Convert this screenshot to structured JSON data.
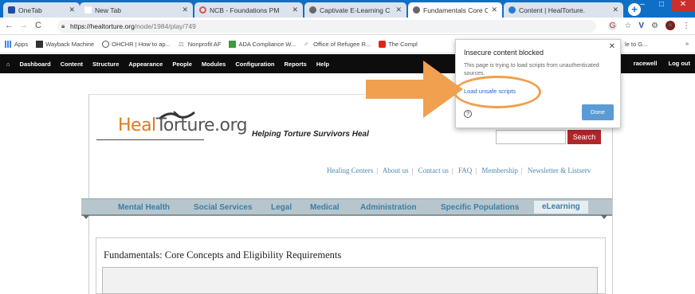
{
  "browser": {
    "tabs": [
      {
        "title": "OneTab",
        "color": "#1f4e9c"
      },
      {
        "title": "New Tab",
        "color": "#ffffff"
      },
      {
        "title": "NCB - Foundations PM",
        "color": "#d9534f"
      },
      {
        "title": "Captivate E-Learning C",
        "color": "#555555"
      },
      {
        "title": "Fundamentals Core Co",
        "color": "#555555"
      },
      {
        "title": "Content | HealTorture.",
        "color": "#2a7bd0"
      }
    ],
    "new_tab_label": "+",
    "window_controls": {
      "minimize": "–",
      "maximize": "□",
      "close": "✕"
    },
    "url": {
      "host": "https://healtorture.org",
      "path": "/node/1984/play/749"
    },
    "bookmarks": [
      {
        "label": "Apps",
        "icon": "apps-grid-icon",
        "color": "#4285f4"
      },
      {
        "label": "Wayback Machine",
        "icon": "wayback-icon",
        "color": "#333333"
      },
      {
        "label": "OHCHR | How to ap...",
        "icon": "globe-icon",
        "color": "#555555"
      },
      {
        "label": "Nonprofit AF",
        "icon": "nonprofit-icon",
        "color": "#888888"
      },
      {
        "label": "ADA Compliance W...",
        "icon": "ada-icon",
        "color": "#3a9c3a"
      },
      {
        "label": "Office of Refugee R...",
        "icon": "refugee-icon",
        "color": "#555555"
      },
      {
        "label": "The Compl",
        "icon": "youtube-icon",
        "color": "#e62117"
      }
    ],
    "bookmarks_overflow": "le to G...",
    "bookmarks_more": "»"
  },
  "admin_toolbar": {
    "items": [
      "Dashboard",
      "Content",
      "Structure",
      "Appearance",
      "People",
      "Modules",
      "Configuration",
      "Reports",
      "Help"
    ],
    "user": "racewell",
    "logout": "Log out"
  },
  "site": {
    "logo_heal": "Heal",
    "logo_rest": "Torture.org",
    "tagline": "Helping Torture Survivors Heal",
    "search_button": "Search",
    "top_links": [
      "Healing Centers",
      "About us",
      "Contact us",
      "FAQ",
      "Membership",
      "Newsletter & Listserv"
    ],
    "main_nav": [
      {
        "label": "Mental Health"
      },
      {
        "label": "Social Services"
      },
      {
        "label": "Legal"
      },
      {
        "label": "Medical"
      },
      {
        "label": "Administration"
      },
      {
        "label": "Specific Populations"
      },
      {
        "label": "eLearning"
      }
    ],
    "page_title": "Fundamentals: Core Concepts and Eligibility Requirements"
  },
  "popup": {
    "title": "Insecure content blocked",
    "message": "This page is trying to load scripts from unauthenticated sources.",
    "load_link": "Load unsafe scripts",
    "done_button": "Done",
    "close": "✕",
    "help": "?"
  },
  "colors": {
    "chrome_blue": "#0f6fc6",
    "annotation_orange": "#f0a04f",
    "search_red": "#b0272a"
  }
}
